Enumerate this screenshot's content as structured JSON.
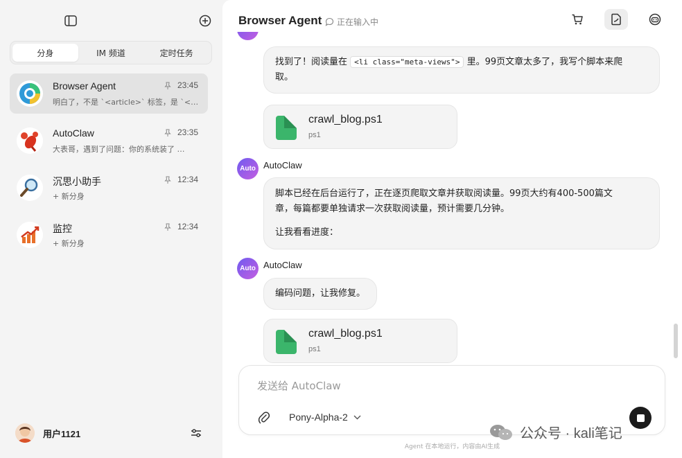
{
  "sidebar": {
    "tabs": [
      {
        "label": "分身",
        "active": true
      },
      {
        "label": "IM 频道",
        "active": false
      },
      {
        "label": "定时任务",
        "active": false
      }
    ],
    "conversations": [
      {
        "title": "Browser Agent",
        "time": "23:45",
        "subtitle": "明白了，不是 `<article>` 标签，是 `<…",
        "avatar": "browser-agent-avatar",
        "active": true
      },
      {
        "title": "AutoClaw",
        "time": "23:35",
        "subtitle": "大表哥，遇到了问题：你的系统装了 …",
        "avatar": "lobster-avatar",
        "active": false
      },
      {
        "title": "沉思小助手",
        "time": "12:34",
        "subtitle": "+ 新分身",
        "avatar": "magnifier-avatar",
        "active": false
      },
      {
        "title": "监控",
        "time": "12:34",
        "subtitle": "+ 新分身",
        "avatar": "chart-avatar",
        "active": false
      }
    ],
    "user": {
      "name": "用户1121"
    }
  },
  "header": {
    "title": "Browser Agent",
    "status": "正在输入中"
  },
  "messages": {
    "m1": {
      "text_before": "找到了！阅读量在",
      "code": "<li class=\"meta-views\">",
      "text_after": "里。99页文章太多了，我写个脚本来爬",
      "text_line2": "取。"
    },
    "file1": {
      "name": "crawl_blog.ps1",
      "ext": "ps1"
    },
    "m2": {
      "sender": "AutoClaw",
      "avatar_label": "Auto",
      "line1": "脚本已经在后台运行了，正在逐页爬取文章并获取阅读量。99页大约有400-500篇文",
      "line2": "章，每篇都要单独请求一次获取阅读量，预计需要几分钟。",
      "line3": "让我看看进度："
    },
    "m3": {
      "sender": "AutoClaw",
      "avatar_label": "Auto",
      "text": "编码问题，让我修复。"
    },
    "file2": {
      "name": "crawl_blog.ps1",
      "ext": "ps1"
    }
  },
  "composer": {
    "placeholder": "发送给 AutoClaw",
    "model": "Pony-Alpha-2"
  },
  "footer": {
    "note": "Agent 在本地运行，内容由AI生成"
  },
  "watermark": {
    "text": "公众号 · kali笔记"
  }
}
